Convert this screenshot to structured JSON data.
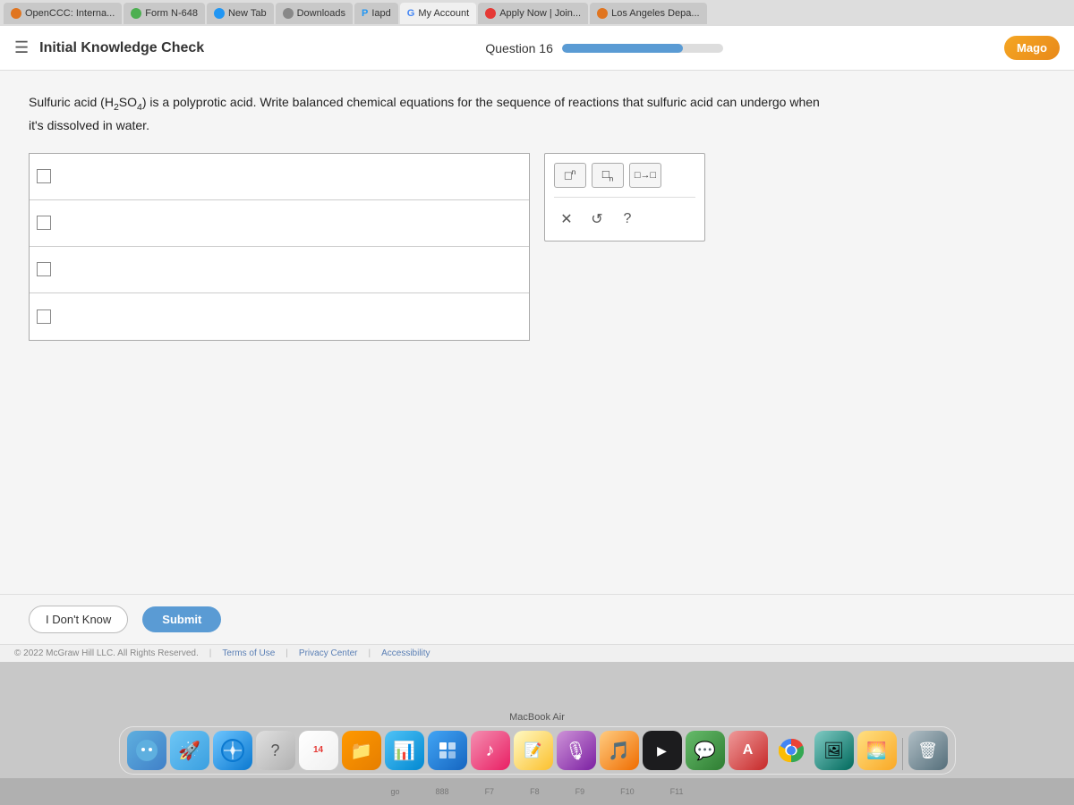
{
  "tabs": [
    {
      "label": "OpenCCC: Interna...",
      "iconType": "orange",
      "active": false
    },
    {
      "label": "Form N-648",
      "iconType": "green",
      "active": false
    },
    {
      "label": "New Tab",
      "iconType": "blue",
      "active": false
    },
    {
      "label": "Downloads",
      "iconType": "gray",
      "active": false
    },
    {
      "label": "Iapd",
      "iconType": "blue",
      "active": false
    },
    {
      "label": "My Account",
      "iconType": "google",
      "active": true
    },
    {
      "label": "Apply Now | Join...",
      "iconType": "red",
      "active": false
    },
    {
      "label": "Los Angeles Depa...",
      "iconType": "orange",
      "active": false
    }
  ],
  "header": {
    "title": "Initial Knowledge Check",
    "question_label": "Question 16",
    "mago_btn": "Mago"
  },
  "question": {
    "text_prefix": "Sulfuric acid ",
    "formula": "(H₂SO₄)",
    "text_suffix": " is a polyprotic acid. Write balanced chemical equations for the sequence of reactions that sulfuric acid can undergo when it's dissolved in water.",
    "rows": [
      {
        "placeholder": ""
      },
      {
        "placeholder": ""
      },
      {
        "placeholder": ""
      },
      {
        "placeholder": ""
      }
    ]
  },
  "toolbar": {
    "btn1_label": "□ⁿ",
    "btn2_label": "□ₙ",
    "btn3_label": "□→□",
    "close_label": "✕",
    "undo_label": "↺",
    "help_label": "?"
  },
  "buttons": {
    "dont_know": "I Don't Know",
    "submit": "Submit"
  },
  "footer": {
    "copyright": "© 2022 McGraw Hill LLC. All Rights Reserved.",
    "terms": "Terms of Use",
    "privacy": "Privacy Center",
    "accessibility": "Accessibility"
  },
  "dock": {
    "macbook_label": "MacBook Air",
    "icons": [
      {
        "name": "Finder",
        "type": "finder",
        "emoji": "🔵"
      },
      {
        "name": "Launchpad",
        "type": "launchpad",
        "emoji": "🚀"
      },
      {
        "name": "Safari",
        "type": "safari",
        "emoji": "🧭"
      },
      {
        "name": "?",
        "type": "question",
        "emoji": "❓"
      },
      {
        "name": "14",
        "type": "calendar",
        "text": "14"
      },
      {
        "name": "Files",
        "type": "orange",
        "emoji": "📁"
      },
      {
        "name": "App",
        "type": "blue2",
        "emoji": "📊"
      },
      {
        "name": "App2",
        "type": "files",
        "emoji": "📄"
      },
      {
        "name": "Music",
        "type": "music",
        "emoji": "♩"
      },
      {
        "name": "Notes",
        "type": "notes",
        "emoji": "📝"
      },
      {
        "name": "Podcast",
        "type": "podcast",
        "emoji": "🎙"
      },
      {
        "name": "Media",
        "type": "music2",
        "emoji": "🎵"
      },
      {
        "name": "TV",
        "type": "appletv",
        "emoji": "📺"
      },
      {
        "name": "Messages",
        "type": "messages",
        "emoji": "💬"
      },
      {
        "name": "Dict",
        "type": "dict",
        "emoji": "A"
      },
      {
        "name": "Chrome",
        "type": "chrome",
        "emoji": "⚙"
      },
      {
        "name": "Preview",
        "type": "preview",
        "emoji": "🖼"
      },
      {
        "name": "Photos",
        "type": "photos",
        "emoji": "🌅"
      },
      {
        "name": "Trash",
        "type": "trash",
        "emoji": "🗑"
      }
    ]
  },
  "keyboard": {
    "keys": [
      "go",
      "888",
      "F7",
      "F8",
      "F9",
      "F10",
      "F11"
    ]
  }
}
